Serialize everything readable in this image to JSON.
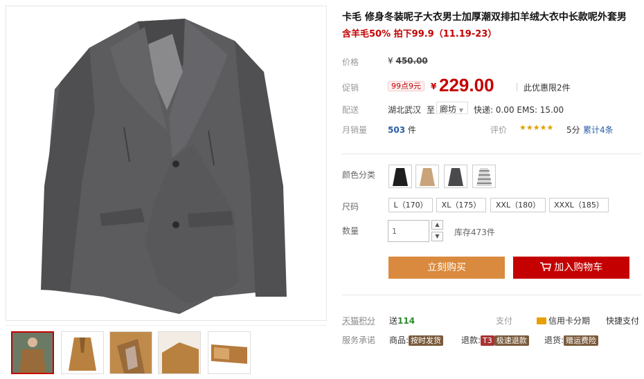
{
  "product": {
    "title": "卡毛 修身冬装呢子大衣男士加厚潮双排扣羊绒大衣中长款呢外套男",
    "subtitle": "含羊毛50% 拍下99.9（11.19-23）"
  },
  "price": {
    "label": "价格",
    "currency": "¥",
    "original": "450.00"
  },
  "promo": {
    "label": "促销",
    "badge": "99点9元",
    "currency": "¥",
    "price": "229.00",
    "limit": "此优惠限2件"
  },
  "shipping": {
    "label": "配送",
    "from": "湖北武汉",
    "to_word": "至",
    "to": "廊坊",
    "fee": "快递: 0.00 EMS: 15.00"
  },
  "sales": {
    "label": "月销量",
    "count": "503",
    "unit": "件",
    "rating_label": "评价",
    "stars": "★★★★★",
    "score": "5分",
    "reviews": "累计4条"
  },
  "color": {
    "label": "颜色分类",
    "options": [
      "black-coat",
      "camel-coat",
      "grey-coat",
      "stripe-coat"
    ]
  },
  "size": {
    "label": "尺码",
    "options": [
      "L（170）",
      "XL（175）",
      "XXL（180）",
      "XXXL（185）"
    ]
  },
  "quantity": {
    "label": "数量",
    "value": "1",
    "stock": "库存473件"
  },
  "buttons": {
    "buy_now": "立刻购买",
    "add_cart": "加入购物车"
  },
  "points": {
    "label": "天猫积分",
    "send": "送",
    "value": "114",
    "pay_label": "支付",
    "credit": "信用卡分期",
    "quick": "快捷支付"
  },
  "service": {
    "label": "服务承诺",
    "goods": "商品:",
    "goods_tag": "按时发货",
    "refund": "退款:",
    "refund_t3": "T3",
    "refund_tag": "极速退款",
    "return": "退货:",
    "return_tag": "赠运费险"
  },
  "colors": {
    "accent_red": "#c40000",
    "buy_orange": "#d98a3e",
    "coat_grey": "#5c5c5e"
  }
}
